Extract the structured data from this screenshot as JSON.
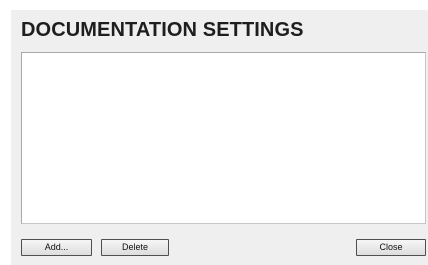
{
  "dialog": {
    "title": "DOCUMENTATION SETTINGS"
  },
  "list": {
    "items": []
  },
  "buttons": {
    "add_label": "Add...",
    "delete_label": "Delete",
    "close_label": "Close"
  }
}
